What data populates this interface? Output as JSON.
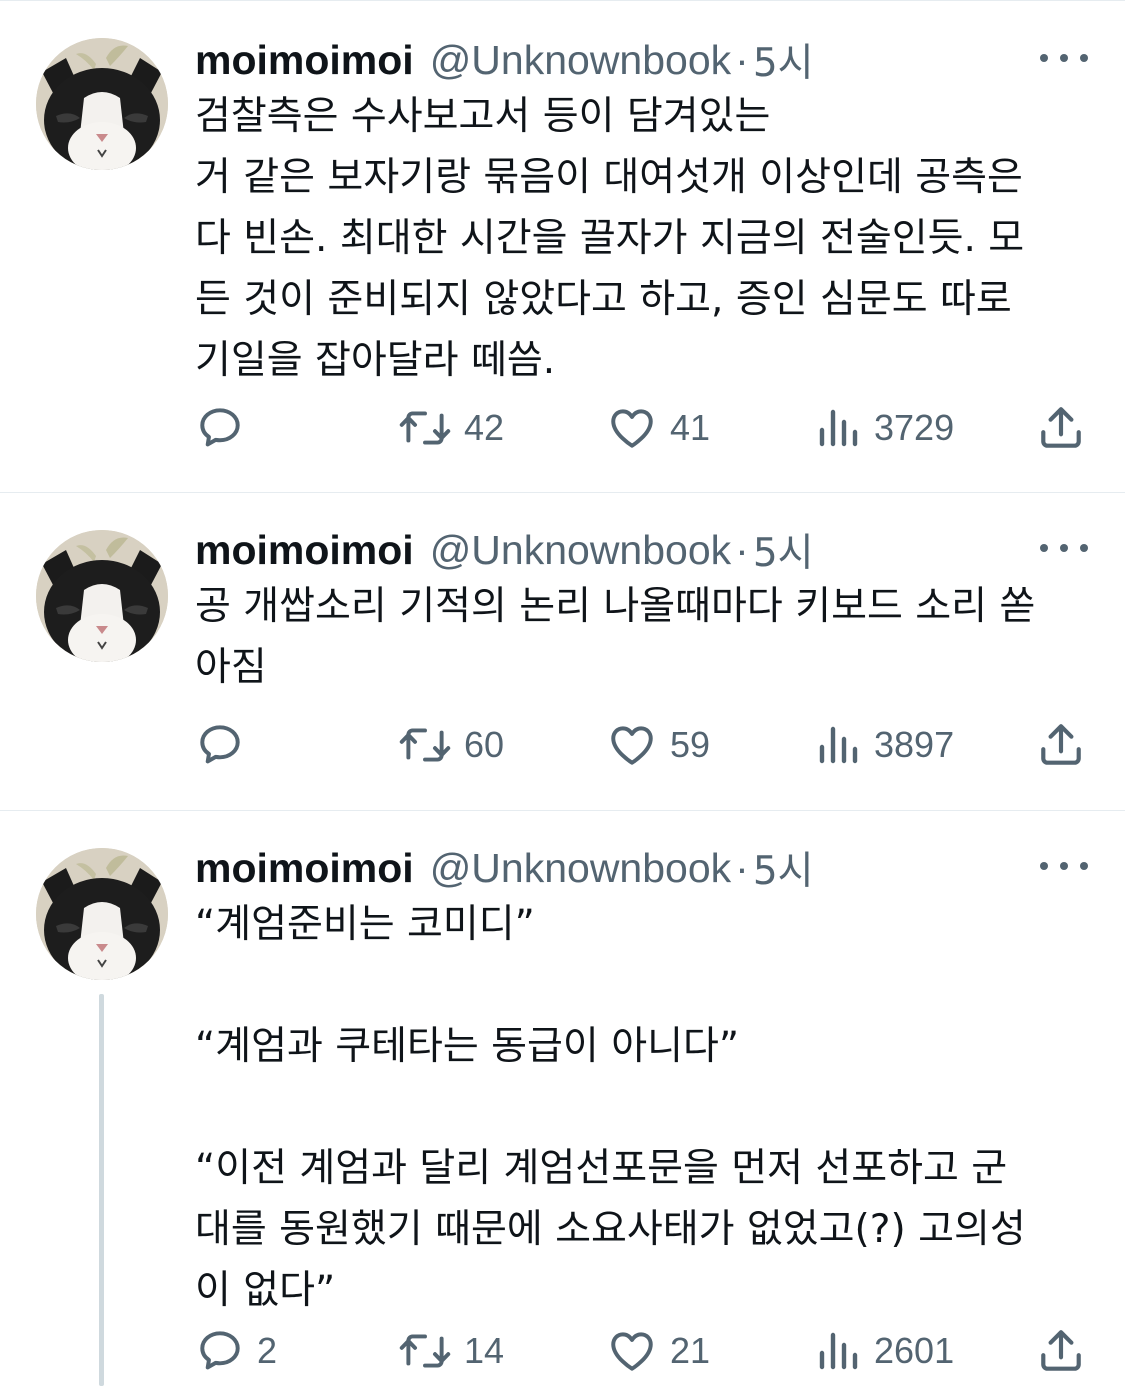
{
  "colors": {
    "text": "#0f1419",
    "secondary": "#536471",
    "divider": "#e6ecf0",
    "thread_line": "#cfd9de"
  },
  "tweets": [
    {
      "name": "moimoimoi",
      "handle": "@Unknownbook",
      "separator": "·",
      "time": "5시",
      "lines": [
        "검찰측은 수사보고서 등이 담겨있는",
        "거 같은 보자기랑 묶음이 대여섯개 이상인데 공측은",
        "다 빈손. 최대한 시간을 끌자가 지금의 전술인듯. 모",
        "든 것이 준비되지 않았다고 하고, 증인 심문도 따로",
        "기일을 잡아달라 떼씀."
      ],
      "reply_count": "",
      "retweet_count": "42",
      "like_count": "41",
      "view_count": "3729"
    },
    {
      "name": "moimoimoi",
      "handle": "@Unknownbook",
      "separator": "·",
      "time": "5시",
      "lines": [
        "공 개쌉소리 기적의 논리 나올때마다 키보드 소리 쏟",
        "아짐"
      ],
      "reply_count": "",
      "retweet_count": "60",
      "like_count": "59",
      "view_count": "3897"
    },
    {
      "name": "moimoimoi",
      "handle": "@Unknownbook",
      "separator": "·",
      "time": "5시",
      "lines": [
        "“계엄준비는 코미디”",
        "",
        "“계엄과 쿠테타는 동급이 아니다”",
        "",
        "“이전 계엄과 달리 계엄선포문을 먼저 선포하고 군",
        "대를 동원했기 때문에 소요사태가 없었고(?) 고의성",
        "이 없다”"
      ],
      "reply_count": "2",
      "retweet_count": "14",
      "like_count": "21",
      "view_count": "2601"
    }
  ]
}
